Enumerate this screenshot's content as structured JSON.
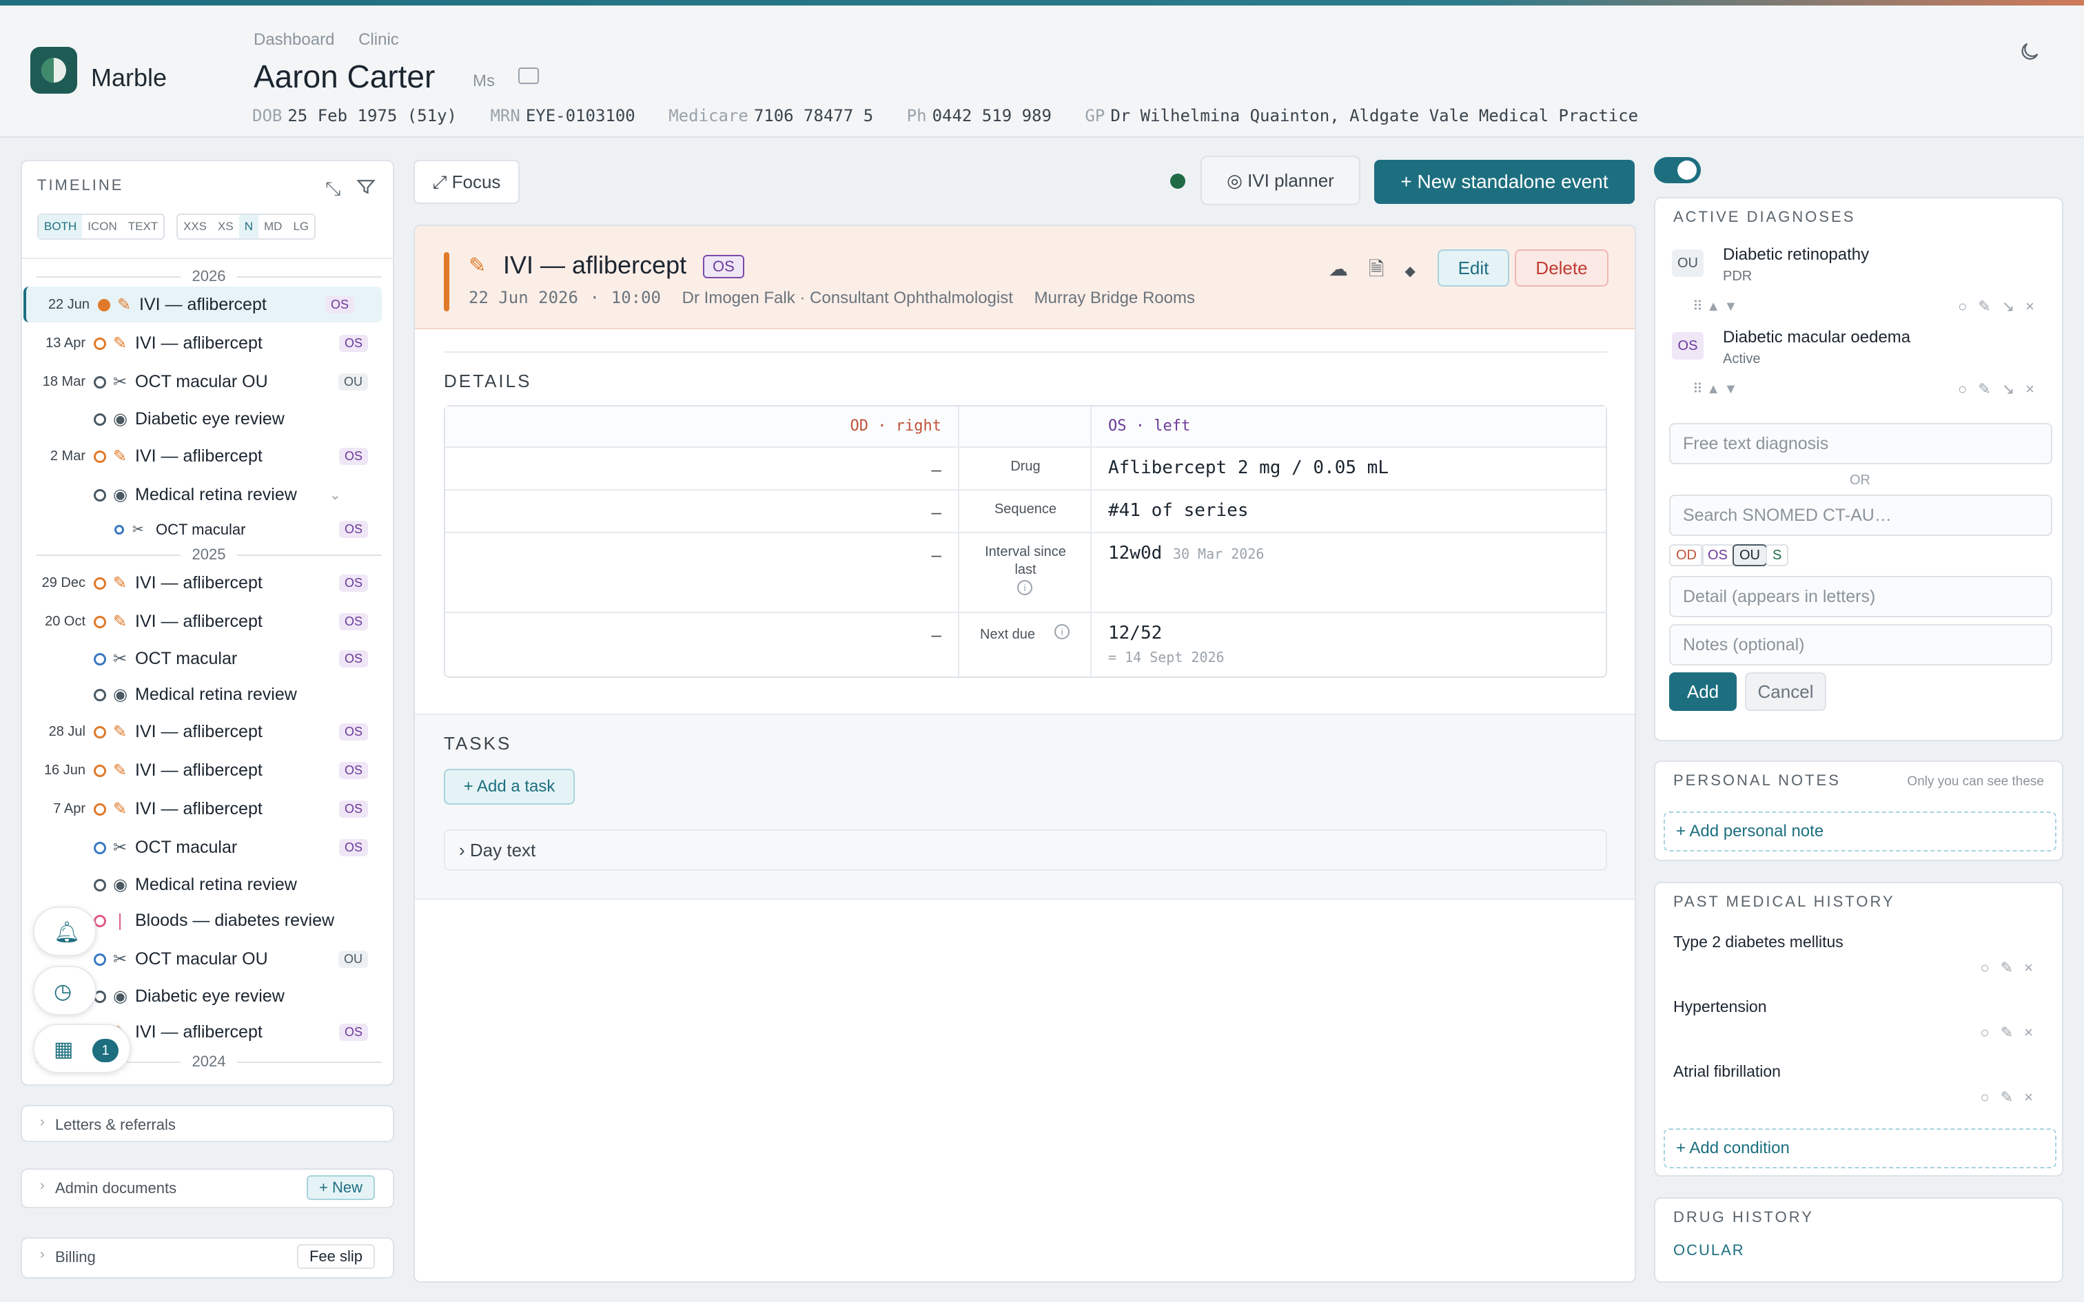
{
  "app": {
    "name": "Marble",
    "breadcrumbs": [
      "Dashboard",
      "Clinic"
    ]
  },
  "patient": {
    "name": "Aaron Carter",
    "title": "Ms",
    "dob_label": "DOB",
    "dob": "25 Feb 1975 (51y)",
    "mrn_label": "MRN",
    "mrn": "EYE-0103100",
    "medicare_label": "Medicare",
    "medicare": "7106 78477 5",
    "ph_label": "Ph",
    "ph": "0442 519 989",
    "gp_label": "GP",
    "gp": "Dr Wilhelmina Quainton, Aldgate Vale Medical Practice"
  },
  "timeline": {
    "title": "TIMELINE",
    "toggles_a": [
      "BOTH",
      "ICON",
      "TEXT"
    ],
    "toggles_b": [
      "XXS",
      "XS",
      "N",
      "MD",
      "LG"
    ],
    "years": [
      "2026",
      "2025",
      "2024"
    ],
    "events": [
      {
        "date": "22 Jun",
        "title": "IVI — aflibercept",
        "badge": "OS"
      },
      {
        "date": "13 Apr",
        "title": "IVI — aflibercept",
        "badge": "OS"
      },
      {
        "date": "18 Mar",
        "title": "OCT macular OU",
        "badge": "OU"
      },
      {
        "date": "",
        "title": "Diabetic eye review",
        "badge": ""
      },
      {
        "date": "2 Mar",
        "title": "IVI — aflibercept",
        "badge": "OS"
      },
      {
        "date": "",
        "title": "Medical retina review",
        "badge": ""
      },
      {
        "date": "",
        "title": "OCT macular",
        "badge": "OS"
      },
      {
        "date": "29 Dec",
        "title": "IVI — aflibercept",
        "badge": "OS"
      },
      {
        "date": "20 Oct",
        "title": "IVI — aflibercept",
        "badge": "OS"
      },
      {
        "date": "",
        "title": "OCT macular",
        "badge": "OS"
      },
      {
        "date": "",
        "title": "Medical retina review",
        "badge": ""
      },
      {
        "date": "28 Jul",
        "title": "IVI — aflibercept",
        "badge": "OS"
      },
      {
        "date": "16 Jun",
        "title": "IVI — aflibercept",
        "badge": "OS"
      },
      {
        "date": "7 Apr",
        "title": "IVI — aflibercept",
        "badge": "OS"
      },
      {
        "date": "",
        "title": "OCT macular",
        "badge": "OS"
      },
      {
        "date": "",
        "title": "Medical retina review",
        "badge": ""
      },
      {
        "date": "",
        "title": "Bloods — diabetes review",
        "badge": ""
      },
      {
        "date": "",
        "title": "OCT macular OU",
        "badge": "OU"
      },
      {
        "date": "",
        "title": "Diabetic eye review",
        "badge": ""
      },
      {
        "date": "",
        "title": "IVI — aflibercept",
        "badge": "OS"
      }
    ],
    "fab_count": "1"
  },
  "panels": {
    "letters": "Letters & referrals",
    "admin": "Admin documents",
    "admin_btn": "+ New",
    "billing": "Billing",
    "billing_btn": "Fee slip"
  },
  "toolbar": {
    "focus": "⤢ Focus",
    "ivi_planner": "◎ IVI planner",
    "new_event": "+ New standalone event"
  },
  "event": {
    "title": "IVI — aflibercept",
    "badge": "OS",
    "date": "22 Jun 2026",
    "time": "10:00",
    "clinician": "Dr Imogen Falk · Consultant Ophthalmologist",
    "location": "Murray Bridge Rooms",
    "edit": "Edit",
    "delete": "Delete"
  },
  "details": {
    "heading": "DETAILS",
    "od_header": "OD · right",
    "os_header": "OS · left",
    "rows": [
      {
        "label": "Drug",
        "od": "–",
        "os": "Aflibercept 2 mg / 0.05 mL",
        "os_sub": ""
      },
      {
        "label": "Sequence",
        "od": "–",
        "os": "#41 of series",
        "os_sub": ""
      },
      {
        "label": "Interval since last",
        "od": "–",
        "os": "12w0d",
        "os_sub": "30 Mar 2026"
      },
      {
        "label": "Next due",
        "od": "–",
        "os": "12/52",
        "os_sub": "= 14 Sept 2026"
      }
    ]
  },
  "tasks": {
    "heading": "TASKS",
    "add": "+ Add a task",
    "day_text": "› Day text"
  },
  "diagnoses": {
    "heading": "ACTIVE DIAGNOSES",
    "items": [
      {
        "lat": "OU",
        "name": "Diabetic retinopathy",
        "status": "PDR"
      },
      {
        "lat": "OS",
        "name": "Diabetic macular oedema",
        "status": "Active"
      }
    ],
    "free_text": "Free text diagnosis",
    "or": "OR",
    "snomed": "Search SNOMED CT-AU…",
    "lat_opts": [
      "OD",
      "OS",
      "OU",
      "S"
    ],
    "detail": "Detail (appears in letters)",
    "notes": "Notes (optional)",
    "add": "Add",
    "cancel": "Cancel"
  },
  "personal_notes": {
    "heading": "PERSONAL NOTES",
    "hint": "Only you can see these",
    "add": "+ Add personal note"
  },
  "pmh": {
    "heading": "PAST MEDICAL HISTORY",
    "items": [
      "Type 2 diabetes mellitus",
      "Hypertension",
      "Atrial fibrillation"
    ],
    "add": "+ Add condition"
  },
  "drug_history": {
    "heading": "DRUG HISTORY",
    "sub": "OCULAR"
  },
  "colors": {
    "accent": "#1d6f80",
    "ivi": "#e07a2a",
    "os": "#6b3a9a",
    "od": "#c0533a"
  }
}
